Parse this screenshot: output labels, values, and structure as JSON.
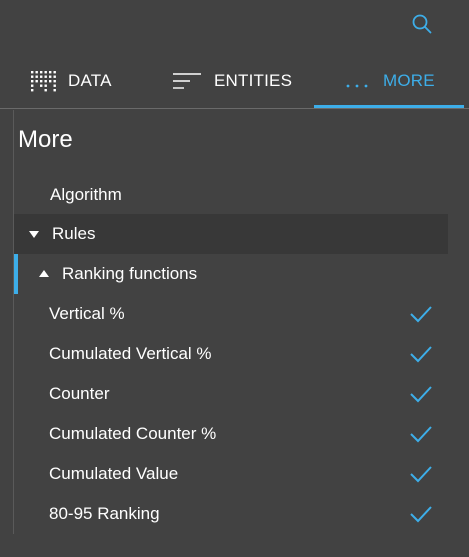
{
  "colors": {
    "background": "#424242",
    "accent": "#3daee9",
    "rules_row": "#383838"
  },
  "header": {
    "search_icon": "search-icon"
  },
  "tabs": [
    {
      "label": "DATA",
      "icon": "grid-bars-icon",
      "active": false
    },
    {
      "label": "ENTITIES",
      "icon": "lines-icon",
      "active": false
    },
    {
      "label": "MORE",
      "icon": "ellipsis-icon",
      "active": true
    }
  ],
  "panel": {
    "title": "More",
    "algorithm_label": "Algorithm",
    "rules_label": "Rules",
    "ranking_label": "Ranking functions",
    "ranking_items": [
      {
        "label": "Vertical %",
        "checked": true
      },
      {
        "label": "Cumulated Vertical %",
        "checked": true
      },
      {
        "label": "Counter",
        "checked": true
      },
      {
        "label": "Cumulated Counter %",
        "checked": true
      },
      {
        "label": "Cumulated Value",
        "checked": true
      },
      {
        "label": "80-95 Ranking",
        "checked": true
      }
    ]
  }
}
